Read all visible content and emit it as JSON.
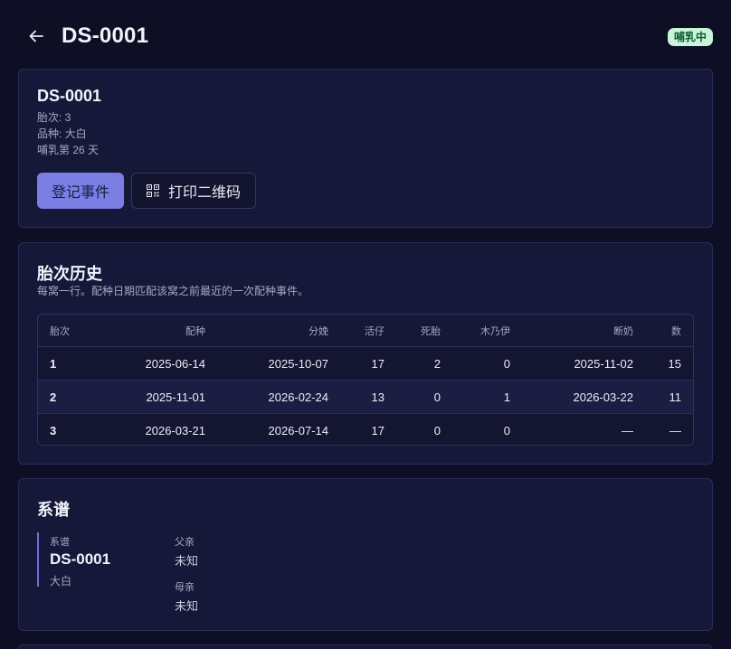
{
  "header": {
    "title": "DS-0001",
    "status": "哺乳中"
  },
  "info": {
    "id": "DS-0001",
    "parity": "胎次: 3",
    "breed": "品种: 大白",
    "lactation": "哺乳第 26 天",
    "register_label": "登记事件",
    "print_label": "打印二维码"
  },
  "history": {
    "title": "胎次历史",
    "subtitle": "每窝一行。配种日期匹配该窝之前最近的一次配种事件。",
    "columns": [
      "胎次",
      "配种",
      "分娩",
      "活仔",
      "死胎",
      "木乃伊",
      "断奶",
      "数"
    ],
    "rows": [
      [
        "1",
        "2025-06-14",
        "2025-10-07",
        "17",
        "2",
        "0",
        "2025-11-02",
        "15"
      ],
      [
        "2",
        "2025-11-01",
        "2026-02-24",
        "13",
        "0",
        "1",
        "2026-03-22",
        "11"
      ],
      [
        "3",
        "2026-03-21",
        "2026-07-14",
        "17",
        "0",
        "0",
        "—",
        "—"
      ]
    ]
  },
  "pedigree": {
    "title": "系谱",
    "self_label": "系谱",
    "self_id": "DS-0001",
    "self_breed": "大白",
    "sire_label": "父亲",
    "sire_value": "未知",
    "dam_label": "母亲",
    "dam_value": "未知"
  },
  "colors": {
    "background": "#0e0f25",
    "card": "#16183a",
    "accent": "#7b7ee3",
    "badge_bg": "#c9f4d9",
    "badge_text": "#0f5b30"
  },
  "icons": {
    "back": "arrow-left-icon",
    "qr": "qr-code-icon"
  }
}
